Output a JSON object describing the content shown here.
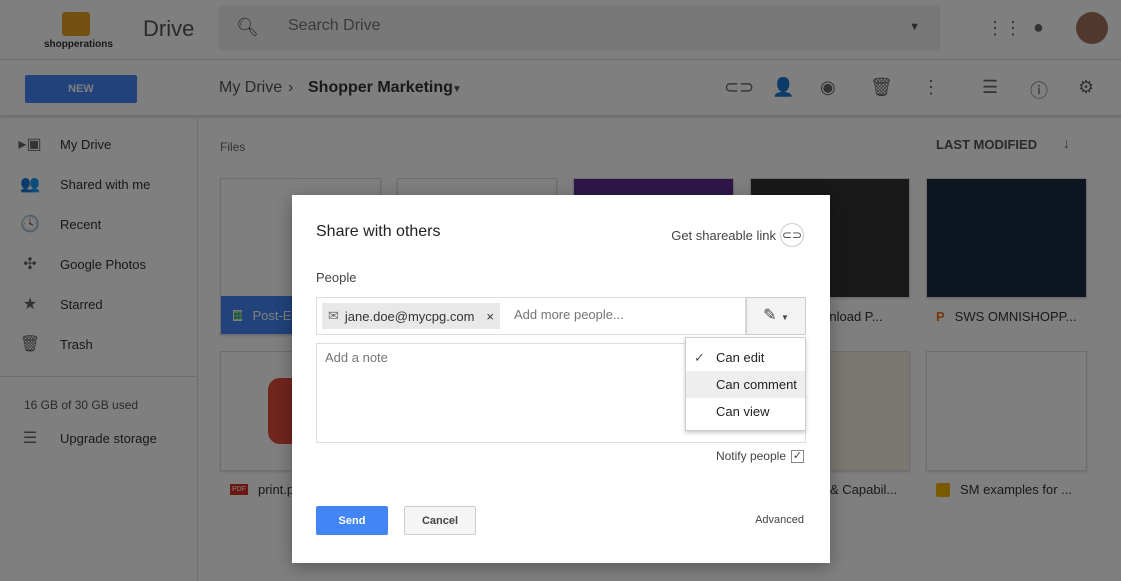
{
  "header": {
    "logo_text": "shopperations",
    "app_title": "Drive",
    "search_placeholder": "Search Drive"
  },
  "toolbar": {
    "new_label": "NEW",
    "breadcrumb": [
      "My Drive",
      "Shopper Marketing"
    ]
  },
  "sidebar": {
    "items": [
      {
        "label": "My Drive",
        "icon": "drive-icon"
      },
      {
        "label": "Shared with me",
        "icon": "people-icon"
      },
      {
        "label": "Recent",
        "icon": "clock-icon"
      },
      {
        "label": "Google Photos",
        "icon": "pinwheel-icon"
      },
      {
        "label": "Starred",
        "icon": "star-icon"
      },
      {
        "label": "Trash",
        "icon": "trash-icon"
      }
    ],
    "storage": "16 GB of 30 GB used",
    "upgrade": "Upgrade storage"
  },
  "main": {
    "section": "Files",
    "sort_label": "LAST MODIFIED",
    "files": [
      {
        "label": "Post-E",
        "type": "sheets"
      },
      {
        "label": "",
        "type": "doc"
      },
      {
        "label": "",
        "type": "purple"
      },
      {
        "label": "wnload P...",
        "type": "video"
      },
      {
        "label": "SWS OMNISHOPP...",
        "type": "slides"
      },
      {
        "label": "print.p",
        "type": "pdf"
      },
      {
        "label": "",
        "type": "blank"
      },
      {
        "label": "",
        "type": "blank"
      },
      {
        "label": "& Capabil...",
        "type": "sheet-thumb"
      },
      {
        "label": "SM examples for ...",
        "type": "slides-yellow"
      }
    ]
  },
  "dialog": {
    "title": "Share with others",
    "get_link": "Get shareable link",
    "people_label": "People",
    "chip_email": "jane.doe@mycpg.com",
    "add_placeholder": "Add more people...",
    "note_placeholder": "Add a note",
    "menu": [
      {
        "label": "Can edit",
        "checked": true
      },
      {
        "label": "Can comment",
        "highlighted": true
      },
      {
        "label": "Can view"
      }
    ],
    "notify_label": "Notify people",
    "notify_checked": true,
    "send": "Send",
    "cancel": "Cancel",
    "advanced": "Advanced"
  }
}
